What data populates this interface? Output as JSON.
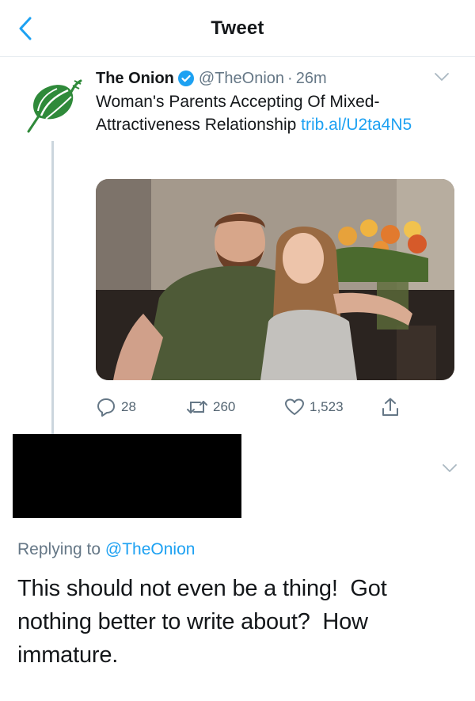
{
  "header": {
    "title": "Tweet",
    "back_icon": "chevron-left-icon"
  },
  "tweet": {
    "author_name": "The Onion",
    "verified_icon": "verified-badge-icon",
    "handle": "@TheOnion",
    "separator": "·",
    "time": "26m",
    "text": "Woman's Parents Accepting Of Mixed-Attractiveness Relationship ",
    "link": "trib.al/U2ta4N5",
    "media_alt": "photo",
    "actions": {
      "replies": "28",
      "retweets": "260",
      "likes": "1,523"
    }
  },
  "reply": {
    "replying_prefix": "Replying to ",
    "replying_to": "@TheOnion",
    "text": "This should not even be a thing!  Got nothing better to write about?  How immature."
  },
  "colors": {
    "accent": "#1da1f2",
    "muted": "#657786",
    "onion_green": "#2f8a3a"
  }
}
